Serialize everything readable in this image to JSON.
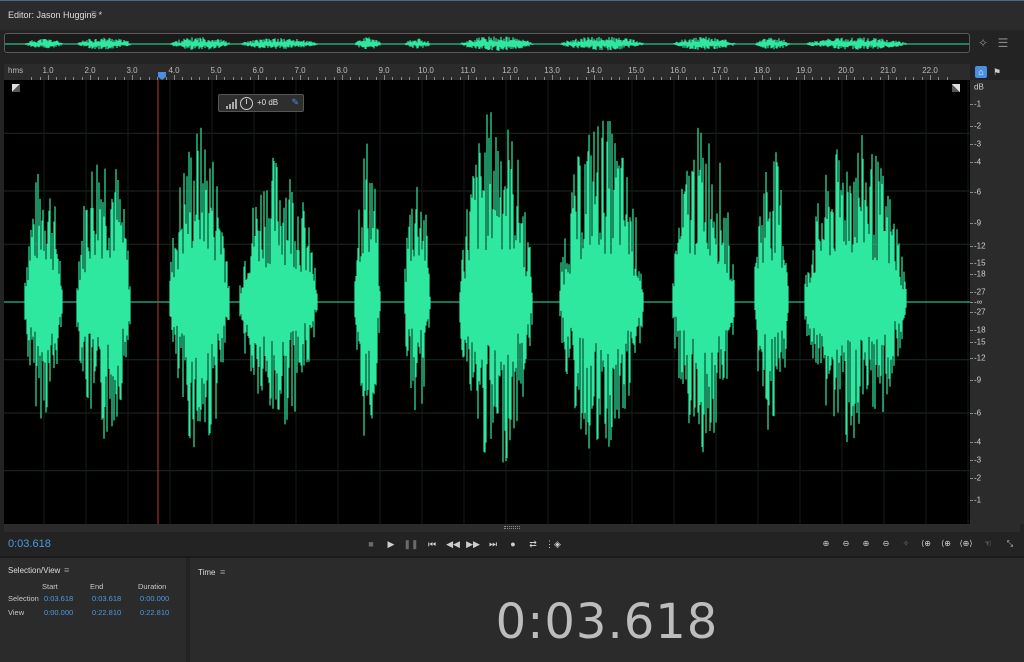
{
  "editor": {
    "title": "Editor: Jason Huggins *",
    "menu_icon": "hamburger-icon"
  },
  "ruler": {
    "unit": "hms",
    "ticks": [
      "1.0",
      "2.0",
      "3.0",
      "4.0",
      "5.0",
      "6.0",
      "7.0",
      "8.0",
      "9.0",
      "10.0",
      "11.0",
      "12.0",
      "13.0",
      "14.0",
      "15.0",
      "16.0",
      "17.0",
      "18.0",
      "19.0",
      "20.0",
      "21.0",
      "22.0"
    ]
  },
  "hud": {
    "value": "+0 dB"
  },
  "db_scale": {
    "unit": "dB",
    "labels": [
      "-1",
      "-2",
      "-3",
      "-4",
      "-6",
      "-9",
      "-12",
      "-15",
      "-18",
      "-27",
      "-∞",
      "-27",
      "-18",
      "-15",
      "-12",
      "-9",
      "-6",
      "-4",
      "-3",
      "-2",
      "-1"
    ]
  },
  "transport": {
    "current_time": "0:03.618"
  },
  "selection_view": {
    "title": "Selection/View",
    "columns": [
      "Start",
      "End",
      "Duration"
    ],
    "rows": [
      {
        "label": "Selection",
        "start": "0:03.618",
        "end": "0:03.618",
        "duration": "0:00.000"
      },
      {
        "label": "View",
        "start": "0:00.000",
        "end": "0:22.810",
        "duration": "0:22.810"
      }
    ]
  },
  "time_panel": {
    "title": "Time",
    "display": "0:03.618"
  },
  "colors": {
    "waveform": "#2ee8a0",
    "accent": "#4a9ae2",
    "playhead": "#c0392b"
  }
}
